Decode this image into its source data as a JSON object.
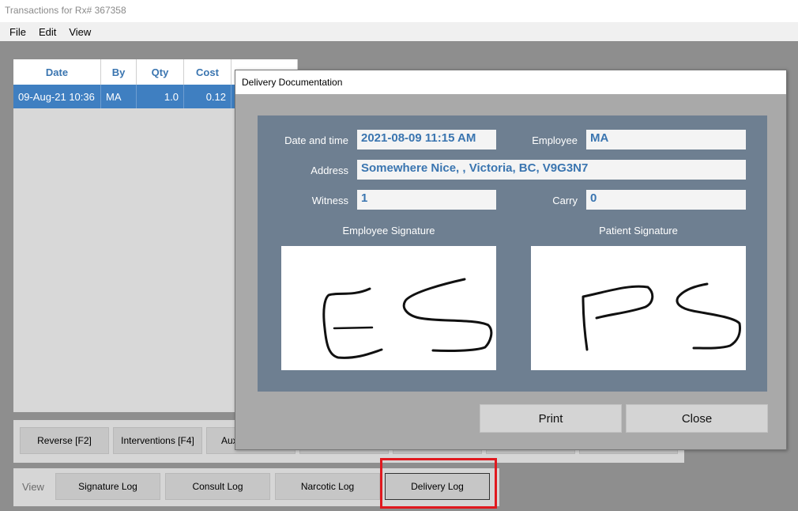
{
  "window": {
    "title": "Transactions for Rx# 367358"
  },
  "menu": [
    "File",
    "Edit",
    "View"
  ],
  "grid": {
    "headers": [
      "Date",
      "By",
      "Qty",
      "Cost",
      "",
      "",
      "",
      "",
      "",
      "",
      ""
    ],
    "rows": [
      {
        "date": "09-Aug-21 10:36",
        "by": "MA",
        "qty": "1.0",
        "cost": "0.12"
      }
    ]
  },
  "toolbar": {
    "reverse": "Reverse [F2]",
    "interventions": "Interventions [F4]",
    "aux": "Aux"
  },
  "viewbar": {
    "label": "View",
    "signature_log": "Signature Log",
    "consult_log": "Consult Log",
    "narcotic_log": "Narcotic Log",
    "delivery_log": "Delivery Log"
  },
  "dialog": {
    "title": "Delivery Documentation",
    "fields": {
      "date_label": "Date and time",
      "date_value": "2021-08-09 11:15 AM",
      "employee_label": "Employee",
      "employee_value": "MA",
      "address_label": "Address",
      "address_value": "Somewhere Nice, , Victoria, BC, V9G3N7",
      "witness_label": "Witness",
      "witness_value": "1",
      "carry_label": "Carry",
      "carry_value": "0"
    },
    "employee_signature_label": "Employee Signature",
    "patient_signature_label": "Patient Signature",
    "employee_signature_text": "ES",
    "patient_signature_text": "PS",
    "print": "Print",
    "close": "Close"
  },
  "colors": {
    "accent": "#3a75b0",
    "selected_row": "#3f7fc1",
    "panel": "#6e7f91",
    "highlight": "#e0191f"
  }
}
